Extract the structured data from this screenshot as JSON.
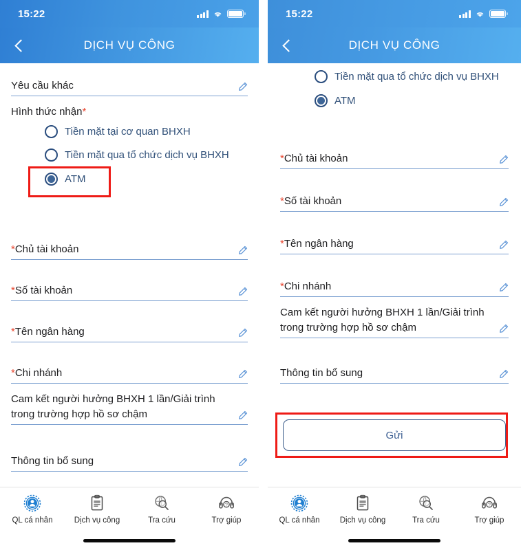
{
  "statusbar": {
    "time": "15:22",
    "icons": [
      "cellular-signal-icon",
      "wifi-icon",
      "battery-icon"
    ]
  },
  "header": {
    "title": "DỊCH VỤ CÔNG",
    "back_icon": "chevron-left-icon"
  },
  "left_screen": {
    "fields_top": [
      {
        "label": "Yêu cầu khác",
        "required": false
      }
    ],
    "radio_group": {
      "label": "Hình thức nhận",
      "required_mark": "*",
      "options": [
        {
          "label": "Tiền mặt tại cơ quan BHXH",
          "selected": false
        },
        {
          "label": "Tiền mặt qua tổ chức dịch vụ BHXH",
          "selected": false
        },
        {
          "label": "ATM",
          "selected": true
        }
      ]
    },
    "fields": [
      {
        "req": "*",
        "label": "Chủ tài khoản"
      },
      {
        "req": "*",
        "label": "Số tài khoản"
      },
      {
        "req": "*",
        "label": "Tên ngân hàng"
      },
      {
        "req": "*",
        "label": "Chi nhánh"
      },
      {
        "req": "",
        "label": "Cam kết người hưởng BHXH 1 lần/Giải trình trong trường hợp hồ sơ chậm"
      },
      {
        "req": "",
        "label": "Thông tin bổ sung"
      }
    ]
  },
  "right_screen": {
    "radio_options": [
      {
        "label": "Tiền mặt qua tổ chức dịch vụ BHXH",
        "selected": false
      },
      {
        "label": "ATM",
        "selected": true
      }
    ],
    "fields": [
      {
        "req": "*",
        "label": "Chủ tài khoản"
      },
      {
        "req": "*",
        "label": "Số tài khoản"
      },
      {
        "req": "*",
        "label": "Tên ngân hàng"
      },
      {
        "req": "*",
        "label": "Chi nhánh"
      },
      {
        "req": "",
        "label": "Cam kết người hưởng BHXH 1 lần/Giải trình trong trường hợp hồ sơ chậm"
      },
      {
        "req": "",
        "label": "Thông tin bổ sung"
      }
    ],
    "submit_label": "Gửi"
  },
  "tabbar": {
    "items": [
      {
        "label": "QL cá nhân",
        "icon": "personal-management-icon",
        "active": true
      },
      {
        "label": "Dịch vụ công",
        "icon": "document-icon",
        "active": false
      },
      {
        "label": "Tra cứu",
        "icon": "search-globe-icon",
        "active": false
      },
      {
        "label": "Trợ giúp",
        "icon": "headset-support-icon",
        "active": false
      }
    ]
  },
  "annotations": {
    "atm_highlight": "red-highlight-box",
    "submit_highlight": "red-highlight-box"
  },
  "colors": {
    "header_blue": "#3f93de",
    "accent_blue": "#4a90d9",
    "required_red": "#e8432c",
    "annotation_red": "#ee1b16",
    "radio_navy": "#2a4d7e"
  }
}
